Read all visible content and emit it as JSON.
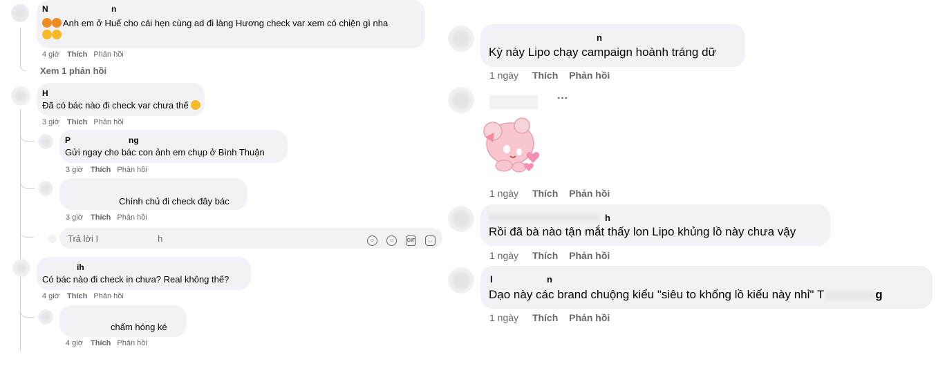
{
  "left": {
    "c1": {
      "name": "N",
      "name_tail": "n",
      "text": "Anh em ở Huế cho cái hẹn cùng ad đi làng Hương check var xem có chiện gì nha",
      "time": "4 giờ",
      "like": "Thích",
      "reply": "Phản hồi",
      "see_replies": "Xem 1 phản hồi"
    },
    "c2": {
      "name": "H",
      "text": "Đã có bác nào đi check var chưa thế",
      "time": "3 giờ",
      "like": "Thích",
      "reply": "Phản hồi"
    },
    "c2r1": {
      "name": "P",
      "name_tail": "ng",
      "text": "Gửi ngay cho bác con ảnh em chụp ở Bình Thuận",
      "time": "3 giờ",
      "like": "Thích",
      "reply": "Phản hồi"
    },
    "c2r2": {
      "text": "Chính chủ đi check đây bác",
      "time": "3 giờ",
      "like": "Thích",
      "reply": "Phản hồi"
    },
    "reply_input": {
      "placeholder_start": "Trả lời I",
      "placeholder_end": "h"
    },
    "c3": {
      "name": "ih",
      "text": "Có bác nào đi check in chưa? Real không thế?",
      "time": "4 giờ",
      "like": "Thích",
      "reply": "Phản hồi"
    },
    "c3r1": {
      "text": "chấm hóng ké",
      "time": "4 giờ",
      "like": "Thích",
      "reply": "Phản hồi"
    }
  },
  "right": {
    "c1": {
      "name": "n",
      "text": "Kỳ này Lipo chạy campaign hoành tráng dữ",
      "time": "1 ngày",
      "like": "Thích",
      "reply": "Phản hồi"
    },
    "c2": {
      "more": "···",
      "time": "1 ngày",
      "like": "Thích",
      "reply": "Phản hồi"
    },
    "c3": {
      "name": "h",
      "text": "Rồi đã bà nào tận mắt thấy lon Lipo khủng lồ này chưa vậy",
      "time": "1 ngày",
      "like": "Thích",
      "reply": "Phản hồi"
    },
    "c4": {
      "name": "l",
      "name_tail": "n",
      "text": "Dạo này các brand chuộng kiểu \"siêu to khổng lồ kiểu này nhỉ\" T",
      "text_tail": "g",
      "time": "1 ngày",
      "like": "Thích",
      "reply": "Phản hồi"
    }
  },
  "colors": {
    "bubble": "#f0f2f5",
    "meta": "#65676b",
    "sticker_pink": "#f7c6cf",
    "heart": "#f48fb1"
  },
  "icons": [
    "camera-icon",
    "emoji-icon",
    "gif-icon",
    "sticker-icon",
    "emoji-reaction-icon"
  ]
}
